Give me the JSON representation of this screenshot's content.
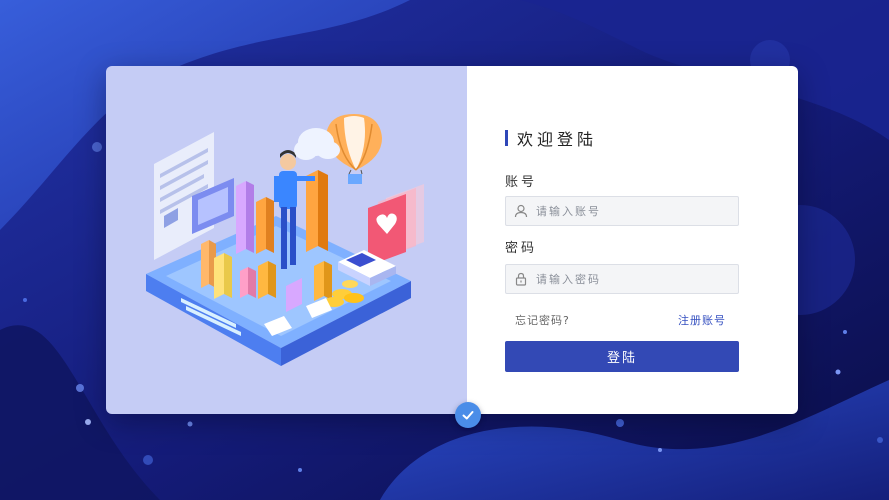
{
  "login": {
    "title": "欢迎登陆",
    "account_label": "账号",
    "account_placeholder": "请输入账号",
    "password_label": "密码",
    "password_placeholder": "请输入密码",
    "forgot_password": "忘记密码?",
    "register": "注册账号",
    "submit": "登陆"
  },
  "icons": {
    "account": "user-icon",
    "password": "lock-icon",
    "badge": "checkmark-icon"
  },
  "colors": {
    "accent": "#3349b5",
    "link": "#3550c0",
    "illustration_bg": "#c5ccf5",
    "page_bg": "#0d1150",
    "badge": "#4a8de8"
  }
}
